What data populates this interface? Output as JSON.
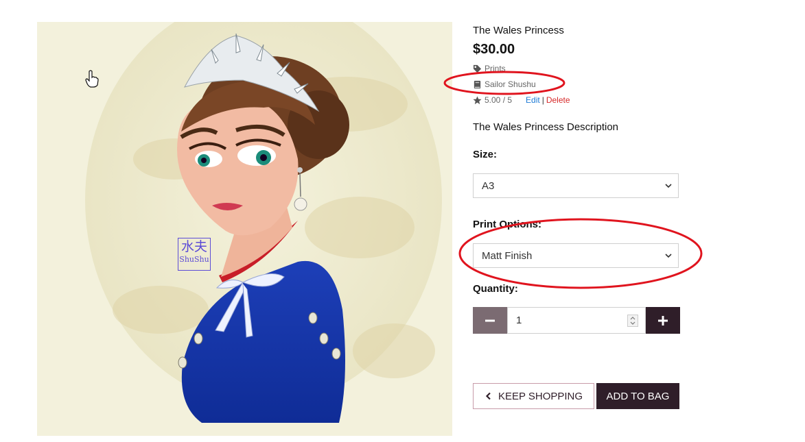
{
  "product": {
    "title": "The Wales Princess",
    "price": "$30.00",
    "category": "Prints",
    "artist": "Sailor Shushu",
    "rating": "5.00 / 5",
    "edit_label": "Edit",
    "separator": "|",
    "delete_label": "Delete",
    "description": "The Wales Princess Description"
  },
  "image": {
    "watermark_cjk": "水夫",
    "watermark_latin": "ShuShu"
  },
  "options": {
    "size_label": "Size:",
    "size_value": "A3",
    "print_label": "Print Options:",
    "print_value": "Matt Finish"
  },
  "quantity": {
    "label": "Quantity:",
    "value": "1"
  },
  "buttons": {
    "keep_shopping": "KEEP SHOPPING",
    "add_to_bag": "ADD TO BAG"
  },
  "colors": {
    "brand_dark": "#2f1e29",
    "minus_bg": "#7b6b72",
    "link_blue": "#1e7bd6",
    "delete_red": "#d62828",
    "annotation_red": "#e0141e"
  },
  "icons": [
    "tag-icon",
    "book-icon",
    "star-icon",
    "chevron-down-icon",
    "minus-icon",
    "plus-icon",
    "chevron-left-icon",
    "hand-cursor-icon"
  ]
}
